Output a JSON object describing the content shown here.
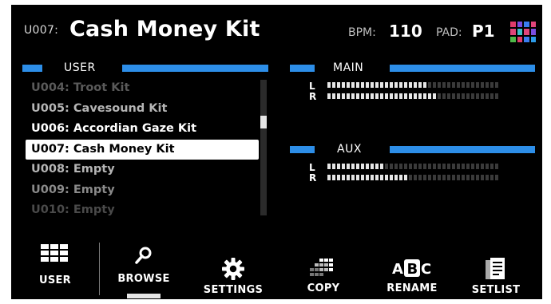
{
  "header": {
    "kit_id": "U007:",
    "kit_name": "Cash Money Kit",
    "bpm_label": "BPM:",
    "bpm_value": "110",
    "pad_label": "PAD:",
    "pad_value": "P1",
    "pad_colors": [
      "#e23b6a",
      "#7a4de0",
      "#3a7df0",
      "#e0457a",
      "#e0457a",
      "#3cc0c8",
      "#e0457a",
      "#7a4de0",
      "#4fb848",
      "#e23b6a",
      "#3a7df0",
      "#2c9be8"
    ]
  },
  "user_section": {
    "title": "USER"
  },
  "main_section": {
    "title": "MAIN"
  },
  "aux_section": {
    "title": "AUX"
  },
  "kits": [
    {
      "label": "U004: Troot Kit",
      "color": "#5a5a5a"
    },
    {
      "label": "U005: Cavesound Kit",
      "color": "#b5b5b5"
    },
    {
      "label": "U006: Accordian Gaze Kit",
      "color": "#ffffff"
    },
    {
      "label": "U007: Cash Money Kit",
      "color": "#000000",
      "selected": true
    },
    {
      "label": "U008: Empty",
      "color": "#b5b5b5"
    },
    {
      "label": "U009: Empty",
      "color": "#8a8a8a"
    },
    {
      "label": "U010: Empty",
      "color": "#4a4a4a"
    }
  ],
  "meters": {
    "labels": {
      "left": "L",
      "right": "R"
    },
    "segments_total": 36,
    "main_left_level": 0.58,
    "main_right_level": 0.64,
    "aux_left_level": 0.33,
    "aux_right_level": 0.47
  },
  "toolbar": {
    "user": "USER",
    "browse": "BROWSE",
    "settings": "SETTINGS",
    "copy": "COPY",
    "rename": "RENAME",
    "setlist": "SETLIST",
    "active": "browse"
  }
}
